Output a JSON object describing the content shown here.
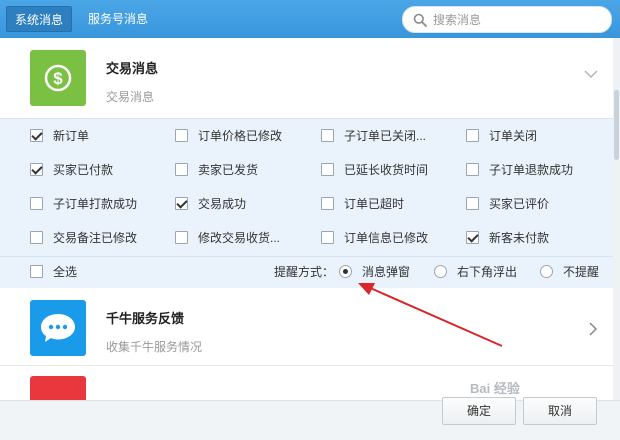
{
  "tabs": [
    {
      "label": "系统消息",
      "active": true
    },
    {
      "label": "服务号消息",
      "active": false
    }
  ],
  "search": {
    "placeholder": "搜索消息",
    "icon": "search-icon"
  },
  "trade": {
    "title": "交易消息",
    "subtitle": "交易消息",
    "icon": "dollar-icon",
    "icon_color": "#7ac143",
    "options": [
      {
        "label": "新订单",
        "checked": true
      },
      {
        "label": "订单价格已修改",
        "checked": false
      },
      {
        "label": "子订单已关闭...",
        "checked": false
      },
      {
        "label": "订单关闭",
        "checked": false
      },
      {
        "label": "买家已付款",
        "checked": true
      },
      {
        "label": "卖家已发货",
        "checked": false
      },
      {
        "label": "已延长收货时间",
        "checked": false
      },
      {
        "label": "子订单退款成功",
        "checked": false
      },
      {
        "label": "子订单打款成功",
        "checked": false
      },
      {
        "label": "交易成功",
        "checked": true
      },
      {
        "label": "订单已超时",
        "checked": false
      },
      {
        "label": "买家已评价",
        "checked": false
      },
      {
        "label": "交易备注已修改",
        "checked": false
      },
      {
        "label": "修改交易收货...",
        "checked": false
      },
      {
        "label": "订单信息已修改",
        "checked": false
      },
      {
        "label": "新客未付款",
        "checked": true
      }
    ],
    "select_all": {
      "label": "全选",
      "checked": false
    },
    "reminder": {
      "label": "提醒方式：",
      "options": [
        {
          "label": "消息弹窗",
          "checked": true
        },
        {
          "label": "右下角浮出",
          "checked": false
        },
        {
          "label": "不提醒",
          "checked": false
        }
      ]
    }
  },
  "qianniu": {
    "title": "千牛服务反馈",
    "subtitle": "收集千牛服务情况",
    "icon": "chat-bubble-icon",
    "icon_color": "#1a9bea"
  },
  "partial_item": {
    "icon_color": "#e8383d"
  },
  "buttons": {
    "ok": "确定",
    "cancel": "取消"
  },
  "watermark": "Bai 经验"
}
